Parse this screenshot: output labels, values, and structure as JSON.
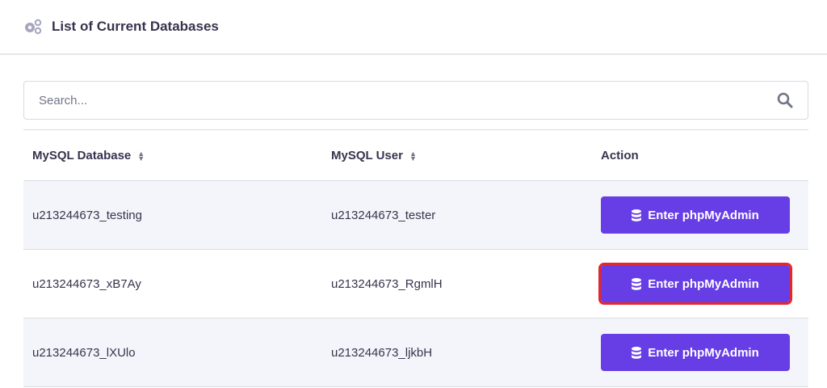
{
  "header": {
    "title": "List of Current Databases"
  },
  "search": {
    "placeholder": "Search..."
  },
  "table": {
    "columns": [
      "MySQL Database",
      "MySQL User",
      "Action"
    ],
    "rows": [
      {
        "database": "u213244673_testing",
        "user": "u213244673_tester",
        "action": "Enter phpMyAdmin"
      },
      {
        "database": "u213244673_xB7Ay",
        "user": "u213244673_RgmlH",
        "action": "Enter phpMyAdmin"
      },
      {
        "database": "u213244673_lXUlo",
        "user": "u213244673_ljkbH",
        "action": "Enter phpMyAdmin"
      }
    ]
  },
  "colors": {
    "accent": "#673de6",
    "highlight": "#e5262b"
  }
}
